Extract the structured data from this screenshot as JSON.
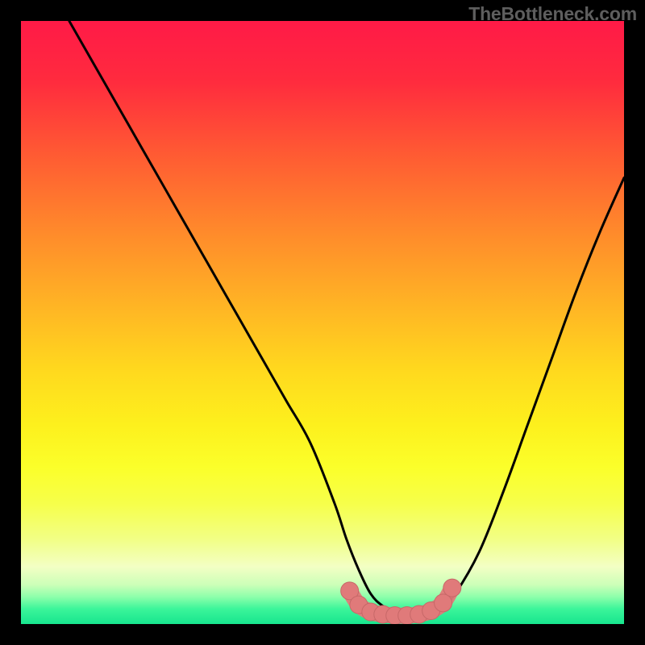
{
  "watermark": "TheBottleneck.com",
  "colors": {
    "gradient_stops": [
      {
        "offset": 0.0,
        "color": "#ff1a47"
      },
      {
        "offset": 0.1,
        "color": "#ff2b3e"
      },
      {
        "offset": 0.22,
        "color": "#ff5a33"
      },
      {
        "offset": 0.35,
        "color": "#ff8a2b"
      },
      {
        "offset": 0.48,
        "color": "#ffb724"
      },
      {
        "offset": 0.58,
        "color": "#ffd91e"
      },
      {
        "offset": 0.67,
        "color": "#fdf01d"
      },
      {
        "offset": 0.74,
        "color": "#fbff2a"
      },
      {
        "offset": 0.8,
        "color": "#f6ff4a"
      },
      {
        "offset": 0.86,
        "color": "#f2ff86"
      },
      {
        "offset": 0.905,
        "color": "#f3ffc4"
      },
      {
        "offset": 0.935,
        "color": "#ccffb8"
      },
      {
        "offset": 0.955,
        "color": "#8dffab"
      },
      {
        "offset": 0.975,
        "color": "#3bf59a"
      },
      {
        "offset": 1.0,
        "color": "#17e58e"
      }
    ],
    "curve": "#000000",
    "marker_fill": "#e07a7a",
    "marker_stroke": "#c76868"
  },
  "chart_data": {
    "type": "line",
    "title": "",
    "xlabel": "",
    "ylabel": "",
    "xlim": [
      0,
      100
    ],
    "ylim": [
      0,
      100
    ],
    "series": [
      {
        "name": "bottleneck-curve",
        "x": [
          8,
          12,
          16,
          20,
          24,
          28,
          32,
          36,
          40,
          44,
          48,
          52,
          54,
          56,
          58,
          60,
          62,
          64,
          66,
          68,
          70,
          72,
          76,
          80,
          84,
          88,
          92,
          96,
          100
        ],
        "y": [
          100,
          93,
          86,
          79,
          72,
          65,
          58,
          51,
          44,
          37,
          30,
          20,
          14,
          9,
          5,
          3,
          2,
          1.5,
          1.5,
          2,
          3,
          5,
          12,
          22,
          33,
          44,
          55,
          65,
          74
        ]
      }
    ],
    "markers": {
      "name": "highlight-band",
      "x": [
        54.5,
        56,
        58,
        60,
        62,
        64,
        66,
        68,
        70,
        71.5
      ],
      "y": [
        5.5,
        3.2,
        2.0,
        1.6,
        1.4,
        1.4,
        1.6,
        2.2,
        3.5,
        6.0
      ]
    }
  }
}
